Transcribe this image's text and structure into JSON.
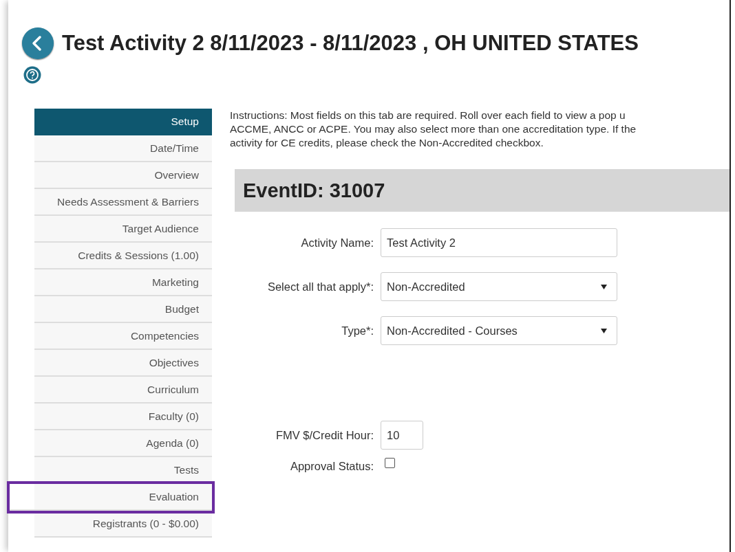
{
  "header": {
    "title": "Test Activity 2 8/11/2023 - 8/11/2023 , OH UNITED STATES"
  },
  "sidebar": {
    "items": [
      {
        "label": "Setup",
        "selected": true,
        "highlighted": false
      },
      {
        "label": "Date/Time",
        "selected": false,
        "highlighted": false
      },
      {
        "label": "Overview",
        "selected": false,
        "highlighted": false
      },
      {
        "label": "Needs Assessment & Barriers",
        "selected": false,
        "highlighted": false
      },
      {
        "label": "Target Audience",
        "selected": false,
        "highlighted": false
      },
      {
        "label": "Credits & Sessions (1.00)",
        "selected": false,
        "highlighted": false
      },
      {
        "label": "Marketing",
        "selected": false,
        "highlighted": false
      },
      {
        "label": "Budget",
        "selected": false,
        "highlighted": false
      },
      {
        "label": "Competencies",
        "selected": false,
        "highlighted": false
      },
      {
        "label": "Objectives",
        "selected": false,
        "highlighted": false
      },
      {
        "label": "Curriculum",
        "selected": false,
        "highlighted": false
      },
      {
        "label": "Faculty (0)",
        "selected": false,
        "highlighted": false
      },
      {
        "label": "Agenda (0)",
        "selected": false,
        "highlighted": false
      },
      {
        "label": "Tests",
        "selected": false,
        "highlighted": false
      },
      {
        "label": "Evaluation",
        "selected": false,
        "highlighted": true
      },
      {
        "label": "Registrants (0 - $0.00)",
        "selected": false,
        "highlighted": false
      }
    ]
  },
  "instructions": [
    "Instructions: Most fields on this tab are required. Roll over each field to view a pop u",
    "ACCME, ANCC or ACPE. You may also select more than one accreditation type. If the",
    "activity for CE credits, please check the Non-Accredited checkbox."
  ],
  "section": {
    "title": "EventID: 31007"
  },
  "fields": [
    {
      "kind": "text",
      "label": "Activity Name:",
      "value": "Test Activity 2"
    },
    {
      "kind": "select",
      "label": "Select all that apply*:",
      "value": "Non-Accredited"
    },
    {
      "kind": "select",
      "label": "Type*:",
      "value": "Non-Accredited - Courses"
    }
  ],
  "extra_fields": [
    {
      "kind": "short",
      "label": "FMV $/Credit Hour:",
      "value": "10"
    },
    {
      "kind": "checkbox",
      "label": "Approval Status:",
      "checked": false
    }
  ]
}
